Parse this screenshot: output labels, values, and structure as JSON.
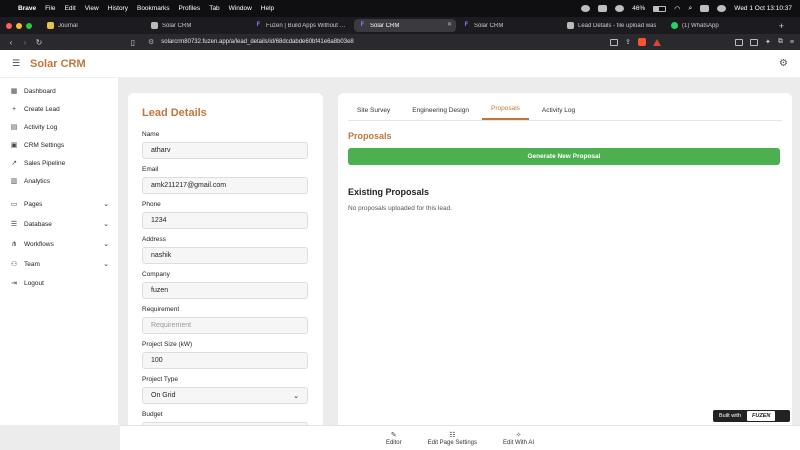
{
  "os_menubar": {
    "app": "Brave",
    "items": [
      "File",
      "Edit",
      "View",
      "History",
      "Bookmarks",
      "Profiles",
      "Tab",
      "Window",
      "Help"
    ],
    "battery": "46%",
    "clock": "Wed 1 Oct  13:10:37"
  },
  "browser": {
    "tabs": [
      {
        "title": "Journal",
        "icon": "journal-icon",
        "color": "#e6c34a"
      },
      {
        "title": "Solar CRM",
        "icon": "page-icon",
        "color": "#bbbbbb"
      },
      {
        "title": "Fuzen | Build Apps Without Co",
        "icon": "fuzen-icon",
        "color": "#6c63ff"
      },
      {
        "title": "Solar CRM",
        "icon": "fuzen-icon",
        "color": "#6c63ff",
        "active": true
      },
      {
        "title": "Solar CRM",
        "icon": "fuzen-icon",
        "color": "#6c63ff"
      },
      {
        "title": "Lead Details - file upload was",
        "icon": "doc-icon",
        "color": "#bbbbbb"
      },
      {
        "title": "(1) WhatsApp",
        "icon": "whatsapp-icon",
        "color": "#25d366"
      }
    ],
    "url": "solarcrm80732.fuzen.app/a/lead_details/id/68dcdabde60bf41e6a8b03e8"
  },
  "app": {
    "brand": "Solar CRM",
    "accent": "#c0763a"
  },
  "sidebar": {
    "items": [
      {
        "label": "Dashboard",
        "icon": "dashboard-icon"
      },
      {
        "label": "Create Lead",
        "icon": "plus-icon"
      },
      {
        "label": "Activity Log",
        "icon": "activity-icon"
      },
      {
        "label": "CRM Settings",
        "icon": "settings-icon"
      },
      {
        "label": "Sales Pipeline",
        "icon": "chart-icon"
      },
      {
        "label": "Analytics",
        "icon": "analytics-icon"
      }
    ],
    "groups": [
      {
        "label": "Pages",
        "icon": "pages-icon"
      },
      {
        "label": "Database",
        "icon": "database-icon"
      },
      {
        "label": "Workflows",
        "icon": "workflow-icon"
      },
      {
        "label": "Team",
        "icon": "team-icon"
      }
    ],
    "logout": "Logout"
  },
  "lead": {
    "title": "Lead Details",
    "fields": [
      {
        "label": "Name",
        "value": "atharv"
      },
      {
        "label": "Email",
        "value": "amk211217@gmail.com"
      },
      {
        "label": "Phone",
        "value": "1234"
      },
      {
        "label": "Address",
        "value": "nashik"
      },
      {
        "label": "Company",
        "value": "fuzen"
      },
      {
        "label": "Requirement",
        "placeholder": "Requirement"
      },
      {
        "label": "Project Size (kW)",
        "value": "100"
      },
      {
        "label": "Project Type",
        "value": "On Grid"
      },
      {
        "label": "Budget",
        "value": ""
      }
    ]
  },
  "panel": {
    "tabs": [
      "Site Survey",
      "Engineering Design",
      "Proposals",
      "Activity Log"
    ],
    "active_tab": "Proposals",
    "section_title": "Proposals",
    "generate_button": "Generate New Proposal",
    "button_color": "#4caf50",
    "existing_title": "Existing Proposals",
    "empty_message": "No proposals uploaded for this lead."
  },
  "badge": {
    "prefix": "Built with",
    "brand": "FUZEN"
  },
  "editor_bar": [
    {
      "label": "Editor",
      "icon": "edit-icon"
    },
    {
      "label": "Edit Page Settings",
      "icon": "sliders-icon"
    },
    {
      "label": "Edit With AI",
      "icon": "magic-wand-icon"
    }
  ]
}
